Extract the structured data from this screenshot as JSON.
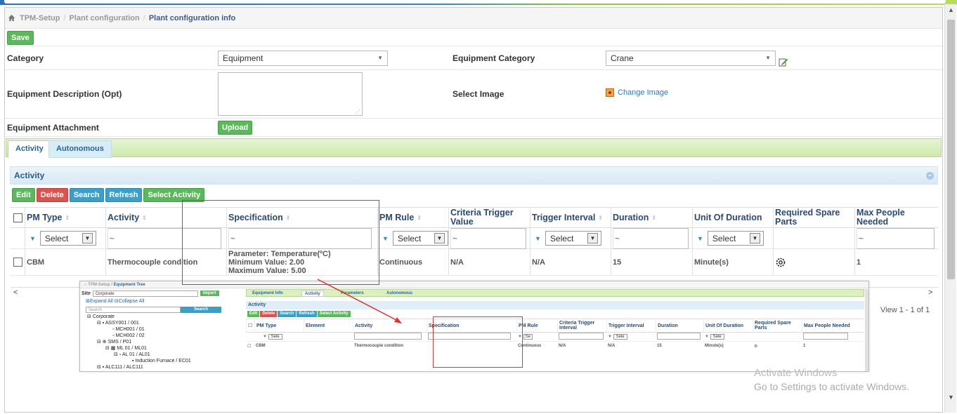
{
  "breadcrumb": {
    "items": [
      "TPM-Setup",
      "Plant configuration"
    ],
    "current": "Plant configuration info"
  },
  "toolbar": {
    "save_label": "Save"
  },
  "form": {
    "category_label": "Category",
    "category_value": "Equipment",
    "equip_category_label": "Equipment Category",
    "equip_category_value": "Crane",
    "description_label": "Equipment Description (Opt)",
    "select_image_label": "Select Image",
    "change_image_link": "Change Image",
    "attachment_label": "Equipment Attachment",
    "upload_label": "Upload"
  },
  "tabs": [
    {
      "label": "Activity"
    },
    {
      "label": "Autonomous"
    }
  ],
  "activity": {
    "title": "Activity",
    "buttons": {
      "edit": "Edit",
      "delete": "Delete",
      "search": "Search",
      "refresh": "Refresh",
      "select_activity": "Select Activity"
    },
    "columns": [
      "PM Type",
      "Activity",
      "Specification",
      "PM Rule",
      "Criteria Trigger Value",
      "Trigger Interval",
      "Duration",
      "Unit Of Duration",
      "Required Spare Parts",
      "Max People Needed"
    ],
    "filter": {
      "select_label": "Select",
      "tilde": "~"
    },
    "row": {
      "pm_type": "CBM",
      "activity": "Thermocouple condition",
      "spec_line1": "Parameter: Temperature(ºC)",
      "spec_line2": "Minimum Value: 2.00",
      "spec_line3": "Maximum Value: 5.00",
      "pm_rule": "Continuous",
      "criteria": "N/A",
      "trigger_interval": "N/A",
      "duration": "15",
      "unit": "Minute(s)",
      "max_people": "1"
    },
    "view_text": "View 1 - 1 of 1"
  },
  "inset": {
    "breadcrumb": {
      "item": "TPM-Setup",
      "current": "Equipment Tree"
    },
    "site_label": "Site",
    "site_value": "Corporate",
    "import_label": "Import",
    "expand_all": "Expand All",
    "collapse_all": "Collapse All",
    "search_placeholder": "Search",
    "search_button": "Search",
    "tree": [
      "Corporate",
      "ASSY001 / 001",
      "MCH001 / 01",
      "MCH002 / 02",
      "SMS / P01",
      "ML 01 / ML01",
      "AL 01 / AL01",
      "Induction Furnace / EC01",
      "ALC111 / ALC111"
    ],
    "tabs": [
      "Equipment Info",
      "Activity",
      "Parameters",
      "Autonomous"
    ],
    "activity_title": "Activity",
    "buttons": [
      "Edit",
      "Delete",
      "Search",
      "Refresh",
      "Select Activity"
    ],
    "columns": [
      "PM Type",
      "Element",
      "Activity",
      "Specification",
      "PM Rule",
      "Criteria Trigger Interval",
      "Trigger Interval",
      "Duration",
      "Unit Of Duration",
      "Required Spare Parts",
      "Max People Needed"
    ],
    "select_short": "Sele",
    "row": {
      "pm_type": "CBM",
      "activity": "Thermocouple condition",
      "pm_rule": "Continuous",
      "criteria": "N/A",
      "interval": "N/A",
      "duration": "15",
      "unit": "Minute(s)",
      "max": "1"
    }
  },
  "watermark": {
    "line1": "Activate Windows",
    "line2": "Go to Settings to activate Windows."
  },
  "colors": {
    "green": "#5cb85c",
    "red": "#d9534f",
    "blue": "#3aa0c8",
    "annotation": "#dd3333"
  }
}
